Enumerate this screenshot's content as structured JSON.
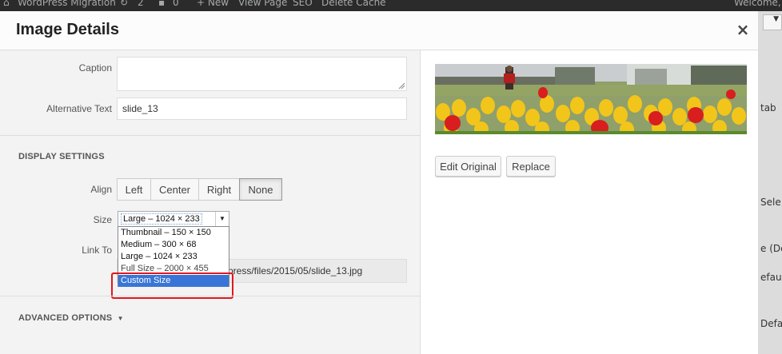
{
  "admin_bar": {
    "site_name": "WordPress Migration",
    "updates_count": "2",
    "comments_count": "0",
    "new_label": "+ New",
    "view_page": "View Page",
    "seo": "SEO",
    "delete_cache": "Delete Cache",
    "welcome": "Welcome,"
  },
  "behind_panel": {
    "text1": "tab",
    "text2": "Sele",
    "text3": "e (De",
    "text4": "efau",
    "text5": "Defa"
  },
  "modal": {
    "title": "Image Details",
    "close_symbol": "×"
  },
  "form": {
    "caption_label": "Caption",
    "caption_value": "",
    "alt_label": "Alternative Text",
    "alt_value": "slide_13",
    "display_settings_title": "DISPLAY SETTINGS",
    "align_label": "Align",
    "align_options": [
      "Left",
      "Center",
      "Right",
      "None"
    ],
    "align_selected": "None",
    "size_label": "Size",
    "size_selected": "Large – 1024 × 233",
    "size_options": [
      "Thumbnail – 150 × 150",
      "Medium – 300 × 68",
      "Large – 1024 × 233",
      "Full Size – 2000 × 455",
      "Custom Size"
    ],
    "size_highlighted": "Custom Size",
    "link_to_label": "Link To",
    "link_url_value": "press/files/2015/05/slide_13.jpg",
    "advanced_options_title": "ADVANCED OPTIONS",
    "advanced_arrow": "▼"
  },
  "preview": {
    "edit_original_label": "Edit Original",
    "replace_label": "Replace"
  }
}
